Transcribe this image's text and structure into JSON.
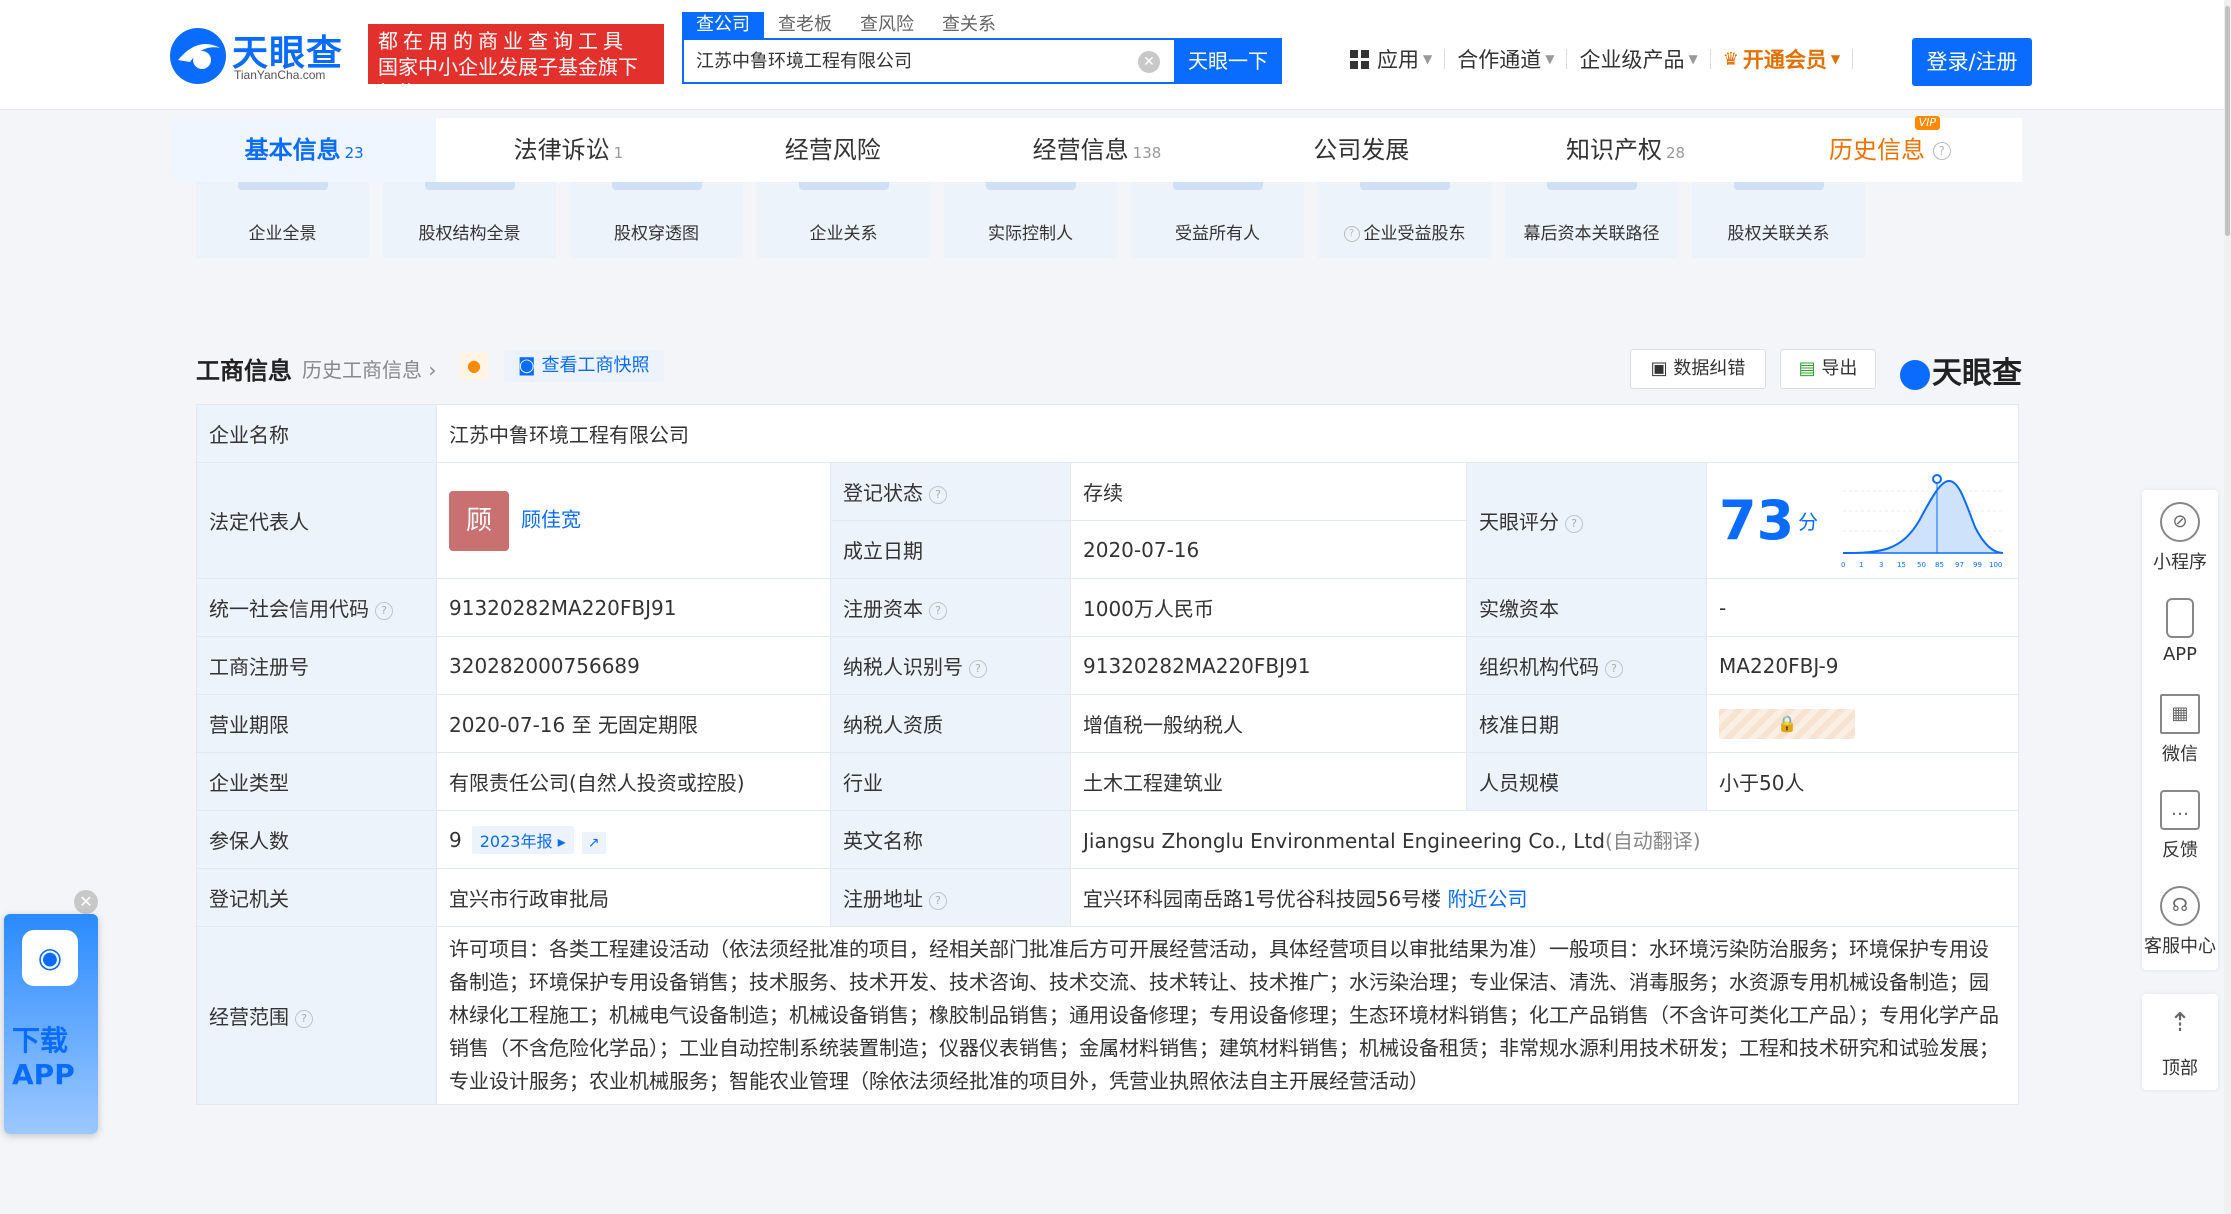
{
  "brand": {
    "logo_text": "天眼查",
    "logo_sub": "TianYanCha.com",
    "slogan_line1": "都在用的商业查询工具",
    "slogan_line2": "国家中小企业发展子基金旗下机构"
  },
  "search": {
    "tabs": [
      "查公司",
      "查老板",
      "查风险",
      "查关系"
    ],
    "value": "江苏中鲁环境工程有限公司",
    "button": "天眼一下"
  },
  "topnav": {
    "apps": "应用",
    "channel": "合作通道",
    "enterprise": "企业级产品",
    "vip": "开通会员",
    "login": "登录/注册"
  },
  "category_tabs": [
    {
      "label": "基本信息",
      "count": "23"
    },
    {
      "label": "法律诉讼",
      "count": "1"
    },
    {
      "label": "经营风险",
      "count": ""
    },
    {
      "label": "经营信息",
      "count": "138"
    },
    {
      "label": "公司发展",
      "count": ""
    },
    {
      "label": "知识产权",
      "count": "28"
    },
    {
      "label": "历史信息",
      "count": "",
      "badge": "VIP"
    }
  ],
  "graph_cards": [
    "企业全景",
    "股权结构全景",
    "股权穿透图",
    "企业关系",
    "实际控制人",
    "受益所有人",
    "企业受益股东",
    "幕后资本关联路径",
    "股权关联关系"
  ],
  "section": {
    "title": "工商信息",
    "history_link": "历史工商信息",
    "snapshot_button": "查看工商快照",
    "correct_button": "数据纠错",
    "export_button": "导出",
    "watermark": "天眼查"
  },
  "info": {
    "company_name_label": "企业名称",
    "company_name": "江苏中鲁环境工程有限公司",
    "legal_rep_label": "法定代表人",
    "legal_rep_avatar": "顾",
    "legal_rep": "顾佳宽",
    "reg_status_label": "登记状态",
    "reg_status": "存续",
    "found_date_label": "成立日期",
    "found_date": "2020-07-16",
    "score_label": "天眼评分",
    "score": "73",
    "score_unit": "分",
    "credit_code_label": "统一社会信用代码",
    "credit_code": "91320282MA220FBJ91",
    "reg_capital_label": "注册资本",
    "reg_capital": "1000万人民币",
    "paid_capital_label": "实缴资本",
    "paid_capital": "-",
    "reg_number_label": "工商注册号",
    "reg_number": "320282000756689",
    "taxpayer_id_label": "纳税人识别号",
    "taxpayer_id": "91320282MA220FBJ91",
    "org_code_label": "组织机构代码",
    "org_code": "MA220FBJ-9",
    "term_label": "营业期限",
    "term": "2020-07-16 至 无固定期限",
    "taxpayer_type_label": "纳税人资质",
    "taxpayer_type": "增值税一般纳税人",
    "approve_date_label": "核准日期",
    "company_type_label": "企业类型",
    "company_type": "有限责任公司(自然人投资或控股)",
    "industry_label": "行业",
    "industry": "土木工程建筑业",
    "staff_size_label": "人员规模",
    "staff_size": "小于50人",
    "insured_label": "参保人数",
    "insured": "9",
    "insured_report": "2023年报",
    "english_name_label": "英文名称",
    "english_name": "Jiangsu Zhonglu Environmental Engineering Co., Ltd",
    "english_note": "(自动翻译)",
    "authority_label": "登记机关",
    "authority": "宜兴市行政审批局",
    "address_label": "注册地址",
    "address": "宜兴环科园南岳路1号优谷科技园56号楼",
    "nearby": "附近公司",
    "scope_label": "经营范围",
    "scope": "许可项目：各类工程建设活动（依法须经批准的项目，经相关部门批准后方可开展经营活动，具体经营项目以审批结果为准）一般项目：水环境污染防治服务；环境保护专用设备制造；环境保护专用设备销售；技术服务、技术开发、技术咨询、技术交流、技术转让、技术推广；水污染治理；专业保洁、清洗、消毒服务；水资源专用机械设备制造；园林绿化工程施工；机械电气设备制造；机械设备销售；橡胶制品销售；通用设备修理；专用设备修理；生态环境材料销售；化工产品销售（不含许可类化工产品）；专用化学产品销售（不含危险化学品）；工业自动控制系统装置制造；仪器仪表销售；金属材料销售；建筑材料销售；机械设备租赁；非常规水源利用技术研发；工程和技术研究和试验发展；专业设计服务；农业机械服务；智能农业管理（除依法须经批准的项目外，凭营业执照依法自主开展经营活动）"
  },
  "score_chart": {
    "x_ticks": [
      "0",
      "1",
      "3",
      "15",
      "50",
      "85",
      "97",
      "99",
      "100"
    ]
  },
  "app_promo": {
    "line1": "下载",
    "line2": "APP"
  },
  "side_bar": [
    "小程序",
    "APP",
    "微信",
    "反馈",
    "客服中心",
    "顶部"
  ]
}
